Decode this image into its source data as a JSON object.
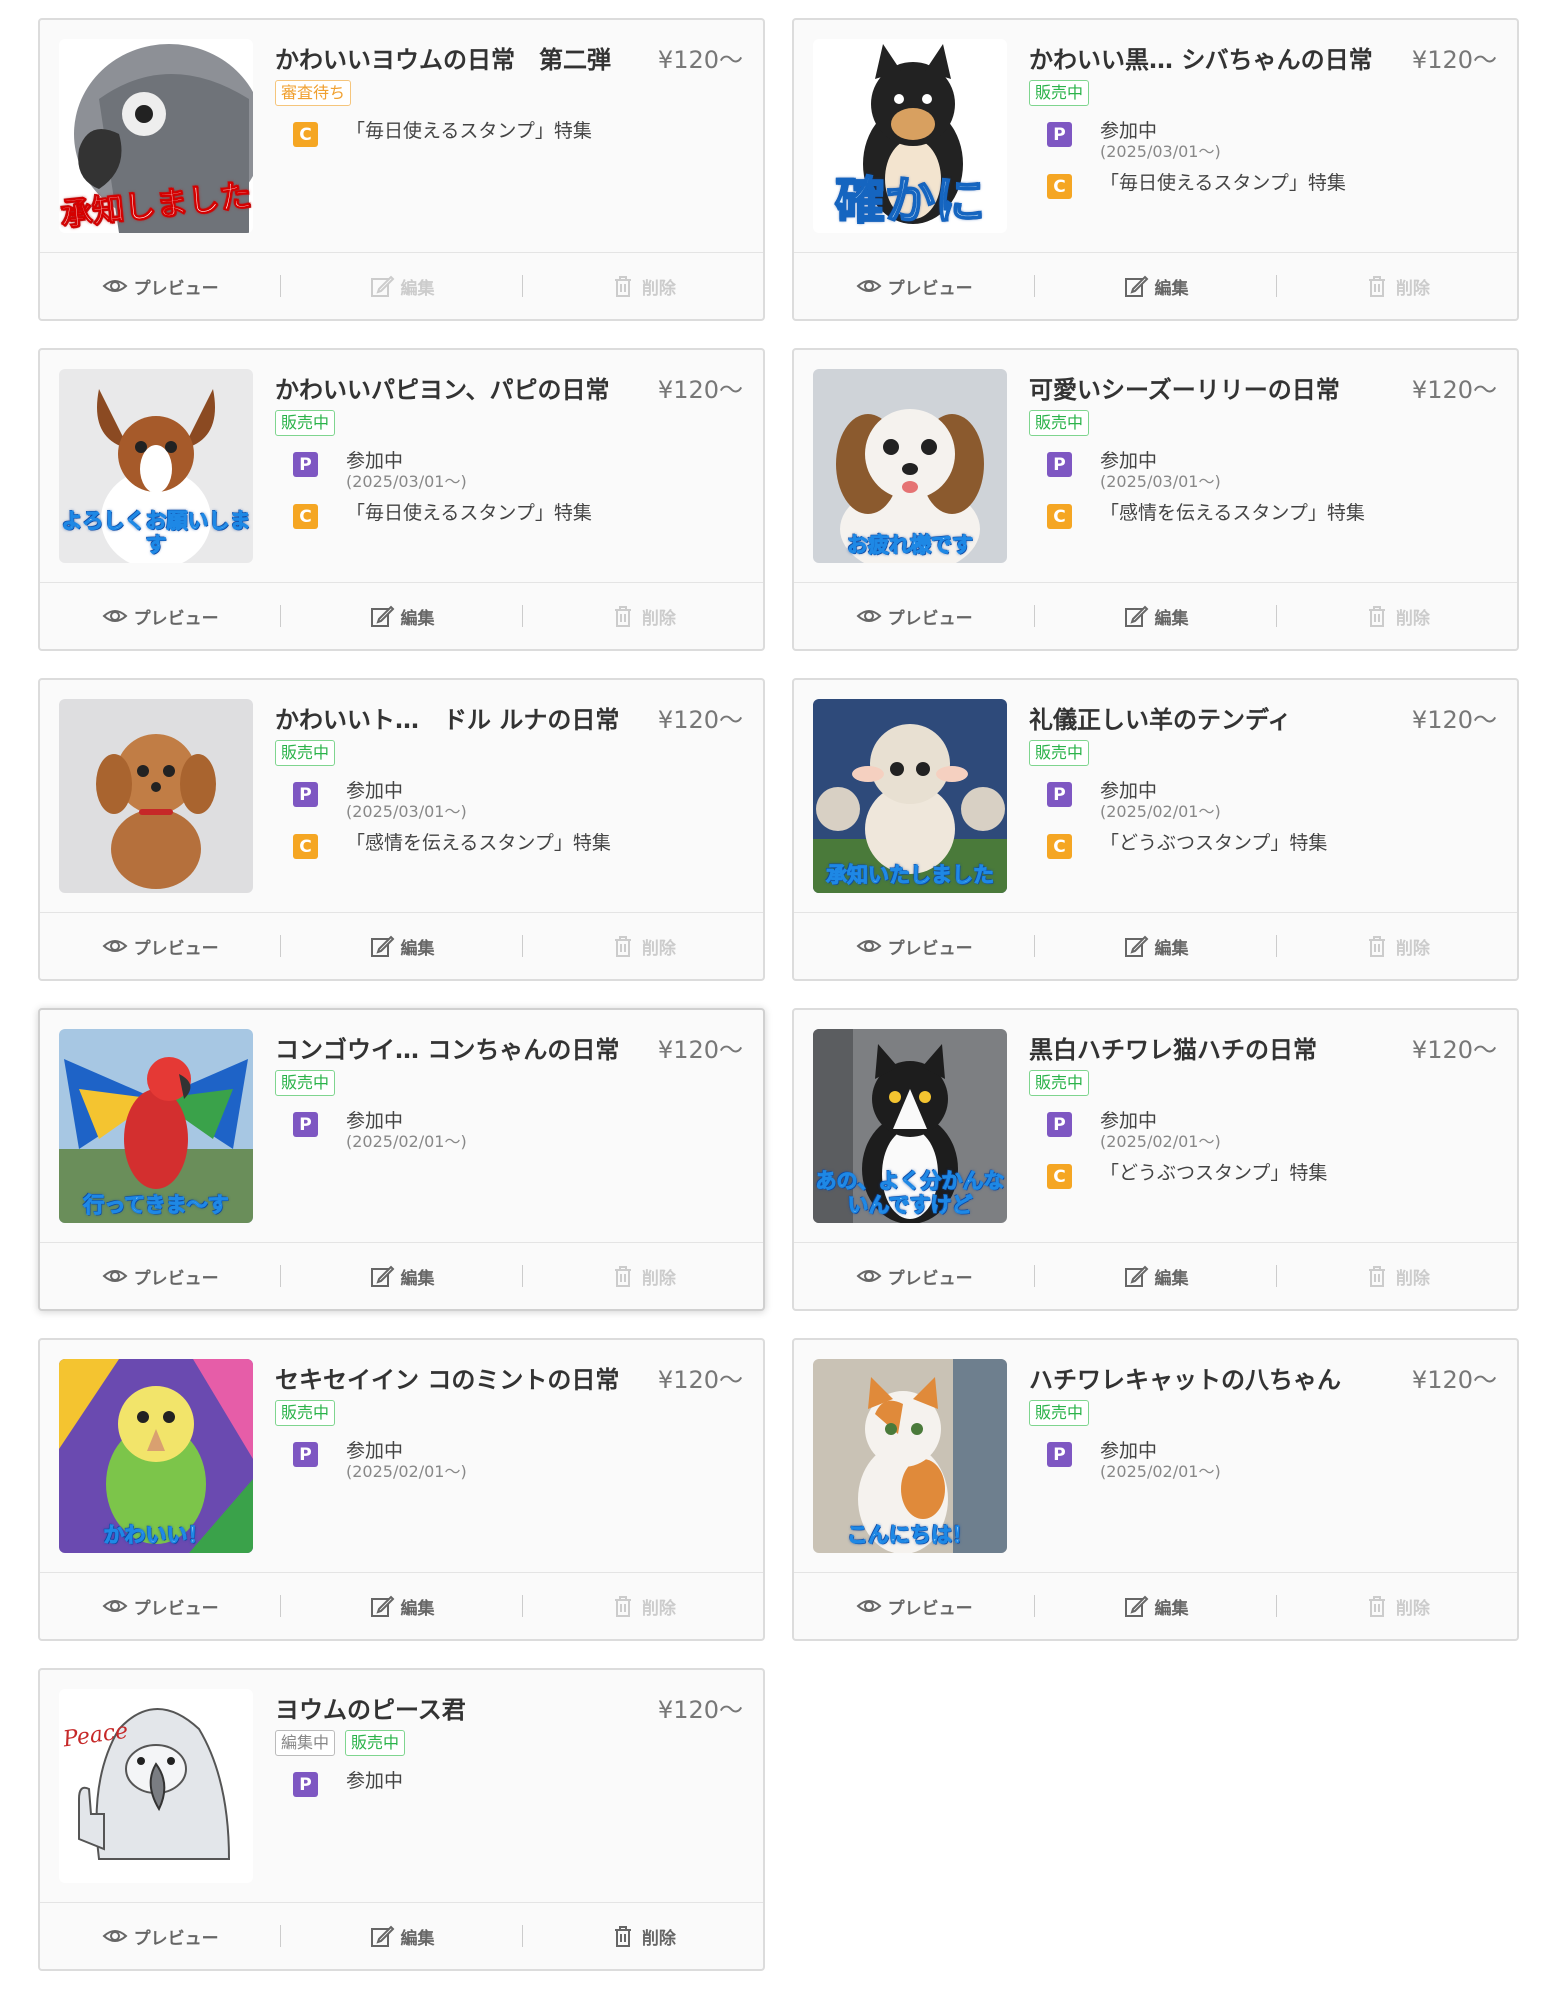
{
  "actions": {
    "preview": "プレビュー",
    "edit": "編集",
    "delete": "削除"
  },
  "cards": [
    {
      "title": "かわいいヨウムの日常　第二弾",
      "price": "¥120〜",
      "badges": [
        {
          "label": "審査待ち",
          "kind": "review"
        }
      ],
      "rows": [
        {
          "icon": "C",
          "text": "「毎日使えるスタンプ」特集",
          "sub": ""
        }
      ],
      "image_caption": "承知しました",
      "image_subject": "grey-parrot",
      "edit_enabled": false,
      "delete_enabled": false
    },
    {
      "title": "かわいい黒… シバちゃんの日常",
      "price": "¥120〜",
      "badges": [
        {
          "label": "販売中",
          "kind": "selling"
        }
      ],
      "rows": [
        {
          "icon": "P",
          "text": "参加中",
          "sub": "(2025/03/01〜)"
        },
        {
          "icon": "C",
          "text": "「毎日使えるスタンプ」特集",
          "sub": ""
        }
      ],
      "image_caption": "確かに",
      "image_subject": "black-shiba",
      "edit_enabled": true,
      "delete_enabled": false
    },
    {
      "title": "かわいいパピヨン、パピの日常",
      "price": "¥120〜",
      "badges": [
        {
          "label": "販売中",
          "kind": "selling"
        }
      ],
      "rows": [
        {
          "icon": "P",
          "text": "参加中",
          "sub": "(2025/03/01〜)"
        },
        {
          "icon": "C",
          "text": "「毎日使えるスタンプ」特集",
          "sub": ""
        }
      ],
      "image_caption": "よろしくお願いします",
      "image_subject": "papillon",
      "edit_enabled": true,
      "delete_enabled": false
    },
    {
      "title": "可愛いシーズーリリーの日常",
      "price": "¥120〜",
      "badges": [
        {
          "label": "販売中",
          "kind": "selling"
        }
      ],
      "rows": [
        {
          "icon": "P",
          "text": "参加中",
          "sub": "(2025/03/01〜)"
        },
        {
          "icon": "C",
          "text": "「感情を伝えるスタンプ」特集",
          "sub": ""
        }
      ],
      "image_caption": "お疲れ様です",
      "image_subject": "shih-tzu",
      "edit_enabled": true,
      "delete_enabled": false
    },
    {
      "title": "かわいいト…　ドル ルナの日常",
      "price": "¥120〜",
      "badges": [
        {
          "label": "販売中",
          "kind": "selling"
        }
      ],
      "rows": [
        {
          "icon": "P",
          "text": "参加中",
          "sub": "(2025/03/01〜)"
        },
        {
          "icon": "C",
          "text": "「感情を伝えるスタンプ」特集",
          "sub": ""
        }
      ],
      "image_caption": "",
      "image_subject": "toy-poodle",
      "edit_enabled": true,
      "delete_enabled": false
    },
    {
      "title": "礼儀正しい羊のテンディ",
      "price": "¥120〜",
      "badges": [
        {
          "label": "販売中",
          "kind": "selling"
        }
      ],
      "rows": [
        {
          "icon": "P",
          "text": "参加中",
          "sub": "(2025/02/01〜)"
        },
        {
          "icon": "C",
          "text": "「どうぶつスタンプ」特集",
          "sub": ""
        }
      ],
      "image_caption": "承知いたしました",
      "image_subject": "sheep",
      "edit_enabled": true,
      "delete_enabled": false
    },
    {
      "title": "コンゴウイ… コンちゃんの日常",
      "price": "¥120〜",
      "badges": [
        {
          "label": "販売中",
          "kind": "selling"
        }
      ],
      "rows": [
        {
          "icon": "P",
          "text": "参加中",
          "sub": "(2025/02/01〜)"
        }
      ],
      "image_caption": "行ってきま〜す",
      "image_subject": "macaw",
      "edit_enabled": true,
      "delete_enabled": false,
      "selected": true
    },
    {
      "title": "黒白ハチワレ猫ハチの日常",
      "price": "¥120〜",
      "badges": [
        {
          "label": "販売中",
          "kind": "selling"
        }
      ],
      "rows": [
        {
          "icon": "P",
          "text": "参加中",
          "sub": "(2025/02/01〜)"
        },
        {
          "icon": "C",
          "text": "「どうぶつスタンプ」特集",
          "sub": ""
        }
      ],
      "image_caption": "あの、よく分かんないんですけど",
      "image_subject": "tuxedo-cat",
      "edit_enabled": true,
      "delete_enabled": false
    },
    {
      "title": "セキセイイン コのミントの日常",
      "price": "¥120〜",
      "badges": [
        {
          "label": "販売中",
          "kind": "selling"
        }
      ],
      "rows": [
        {
          "icon": "P",
          "text": "参加中",
          "sub": "(2025/02/01〜)"
        }
      ],
      "image_caption": "かわいい！",
      "image_subject": "budgie",
      "edit_enabled": true,
      "delete_enabled": false
    },
    {
      "title": "ハチワレキャットの八ちゃん",
      "price": "¥120〜",
      "badges": [
        {
          "label": "販売中",
          "kind": "selling"
        }
      ],
      "rows": [
        {
          "icon": "P",
          "text": "参加中",
          "sub": "(2025/02/01〜)"
        }
      ],
      "image_caption": "こんにちは！",
      "image_subject": "calico-cat",
      "edit_enabled": true,
      "delete_enabled": false
    },
    {
      "title": "ヨウムのピース君",
      "price": "¥120〜",
      "badges": [
        {
          "label": "編集中",
          "kind": "editing"
        },
        {
          "label": "販売中",
          "kind": "selling"
        }
      ],
      "rows": [
        {
          "icon": "P",
          "text": "参加中",
          "sub": ""
        }
      ],
      "image_caption": "Peace",
      "image_subject": "parrot-sketch",
      "edit_enabled": true,
      "delete_enabled": true
    }
  ],
  "colors": {
    "selling": "#2bb34a",
    "review": "#f0a030",
    "p_icon": "#7e57c2",
    "c_icon": "#f5a623"
  }
}
